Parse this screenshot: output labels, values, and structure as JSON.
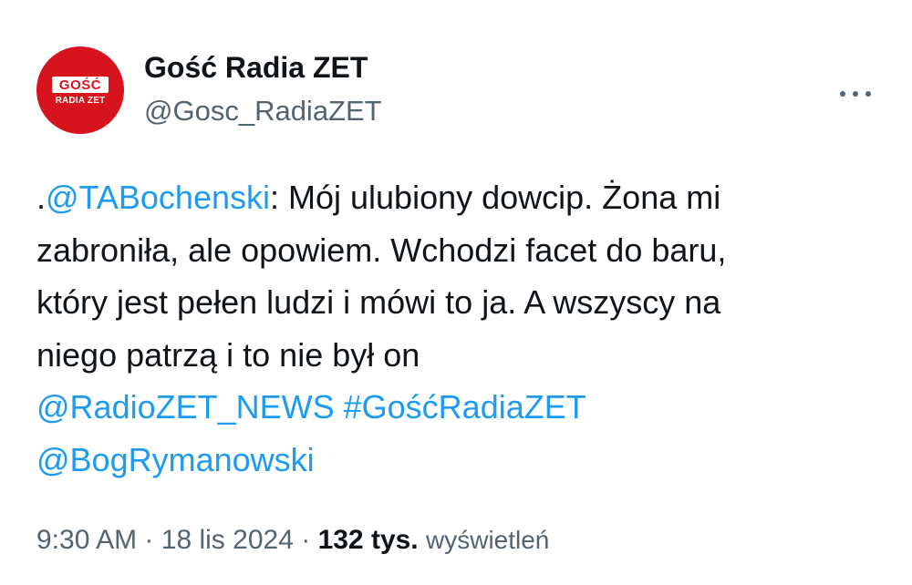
{
  "author": {
    "display_name": "Gość Radia ZET",
    "handle": "@Gosc_RadiaZET",
    "avatar_text_line1": "GOŚĆ",
    "avatar_text_line2": "RADIA ZET",
    "avatar_color": "#d7141d"
  },
  "more_icon": "more-horizontal-icon",
  "tweet": {
    "line1_prefix": ".",
    "line1_mention": "@TABochenski",
    "line1_rest": ": Mój ulubiony dowcip. Żona mi",
    "line2": "zabroniła, ale opowiem. Wchodzi facet do baru,",
    "line3": "który jest pełen ludzi i mówi to ja. A wszyscy na",
    "line4": "niego patrzą i to nie był on",
    "mention_radiozet": "@RadioZET_NEWS",
    "hashtag": "#GośćRadiaZET",
    "mention_bog": "@BogRymanowski"
  },
  "meta": {
    "time": "9:30 AM",
    "separator": "·",
    "date": "18 lis 2024",
    "views_count": "132 tys.",
    "views_label": "wyświetleń"
  },
  "colors": {
    "text": "#0f1419",
    "secondary": "#536471",
    "link": "#1d9bf0"
  }
}
